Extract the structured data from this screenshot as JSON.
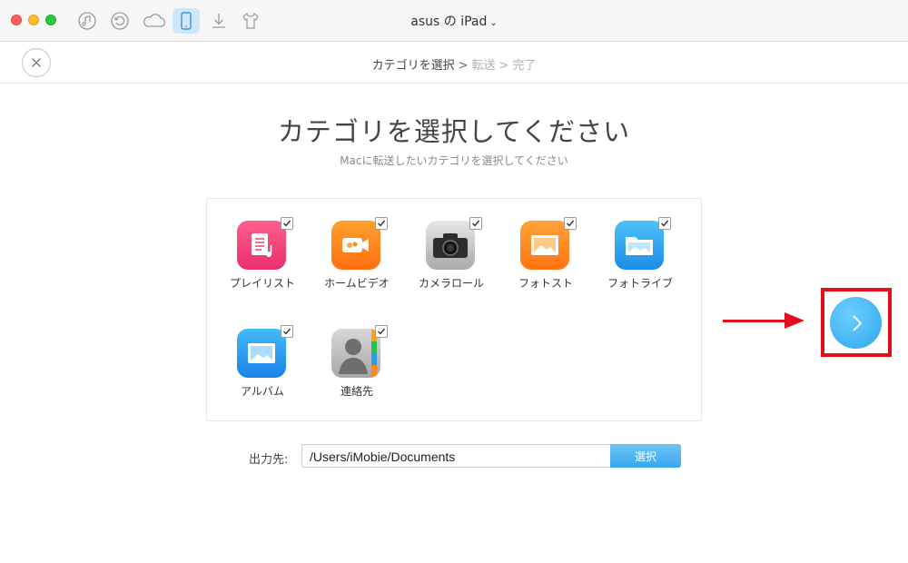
{
  "window": {
    "device_title": "asus の iPad",
    "toolbar_icons": [
      "music-icon",
      "restore-icon",
      "cloud-icon",
      "device-icon",
      "download-icon",
      "shirt-icon"
    ]
  },
  "steps": {
    "current": "カテゴリを選択",
    "separator": ">",
    "step2": "転送",
    "separator2": ">",
    "step3": "完了"
  },
  "main": {
    "heading": "カテゴリを選択してください",
    "subheading": "Macに転送したいカテゴリを選択してください"
  },
  "categories": [
    {
      "label": "プレイリスト",
      "icon": "playlist-icon",
      "checked": true,
      "color": "#f0407a"
    },
    {
      "label": "ホームビデオ",
      "icon": "home-video-icon",
      "checked": true,
      "color": "#ff8a1c"
    },
    {
      "label": "カメラロール",
      "icon": "camera-icon",
      "checked": true,
      "color": "#9a9a9a"
    },
    {
      "label": "フォトスト",
      "icon": "photo-stream-icon",
      "checked": true,
      "color": "#ff8c1a"
    },
    {
      "label": "フォトライブ",
      "icon": "photo-library-icon",
      "checked": true,
      "color": "#26a7ee"
    },
    {
      "label": "アルバム",
      "icon": "album-icon",
      "checked": true,
      "color": "#2a9bf0"
    },
    {
      "label": "連絡先",
      "icon": "contacts-icon",
      "checked": true,
      "color": "#a0a0a0"
    }
  ],
  "output": {
    "label": "出力先:",
    "path": "/Users/iMobie/Documents",
    "button": "選択"
  },
  "colors": {
    "accent": "#3aa7ee",
    "highlight": "#e10f1b"
  }
}
